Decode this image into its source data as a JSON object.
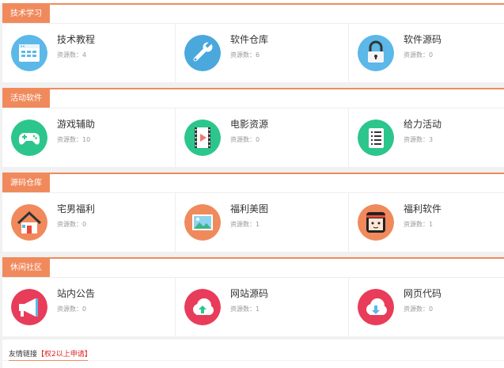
{
  "sections": [
    {
      "title": "技术学习",
      "items": [
        {
          "name": "技术教程",
          "count": "资源数：4",
          "icon": "browser-window-icon",
          "color": "#5bb8e8"
        },
        {
          "name": "软件仓库",
          "count": "资源数：6",
          "icon": "wrench-icon",
          "color": "#4aa8dd"
        },
        {
          "name": "软件源码",
          "count": "资源数：0",
          "icon": "lock-icon",
          "color": "#5bb8e8"
        }
      ]
    },
    {
      "title": "活动软件",
      "items": [
        {
          "name": "游戏辅助",
          "count": "资源数：10",
          "icon": "gamepad-icon",
          "color": "#2cc68c"
        },
        {
          "name": "电影资源",
          "count": "资源数：0",
          "icon": "film-play-icon",
          "color": "#2cc68c"
        },
        {
          "name": "给力活动",
          "count": "资源数：3",
          "icon": "document-list-icon",
          "color": "#2cc68c"
        }
      ]
    },
    {
      "title": "源码仓库",
      "items": [
        {
          "name": "宅男福利",
          "count": "资源数：0",
          "icon": "house-icon",
          "color": "#f08a5d"
        },
        {
          "name": "福利美图",
          "count": "资源数：1",
          "icon": "landscape-picture-icon",
          "color": "#f08a5d"
        },
        {
          "name": "福利软件",
          "count": "资源数：1",
          "icon": "girl-face-icon",
          "color": "#f08a5d"
        }
      ]
    },
    {
      "title": "休闲社区",
      "items": [
        {
          "name": "站内公告",
          "count": "资源数：0",
          "icon": "megaphone-icon",
          "color": "#e83c5a"
        },
        {
          "name": "网站源码",
          "count": "资源数：1",
          "icon": "cloud-upload-icon",
          "color": "#e83c5a"
        },
        {
          "name": "网页代码",
          "count": "资源数：0",
          "icon": "cloud-download-icon",
          "color": "#e83c5a"
        }
      ]
    }
  ],
  "friends": {
    "title": "友情链接",
    "apply": "【权2以上申请】"
  },
  "colors": {
    "accent": "#f08a5d",
    "blue": "#5bb8e8",
    "green": "#2cc68c",
    "orange": "#f08a5d",
    "red": "#e83c5a"
  }
}
